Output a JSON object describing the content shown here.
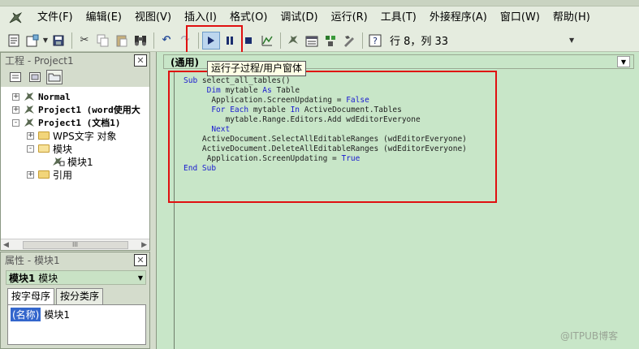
{
  "menubar": {
    "items": [
      "文件(F)",
      "编辑(E)",
      "视图(V)",
      "插入(I)",
      "格式(O)",
      "调试(D)",
      "运行(R)",
      "工具(T)",
      "外接程序(A)",
      "窗口(W)",
      "帮助(H)"
    ]
  },
  "toolbar": {
    "position_text": "行 8，列 33",
    "tooltip": "运行子过程/用户窗体",
    "run_highlight_color": "#e01010"
  },
  "project": {
    "title": "工程 - Project1",
    "tree": [
      {
        "label": "Normal",
        "state": "+"
      },
      {
        "label": "Project1 (word使用大",
        "state": "+"
      },
      {
        "label": "Project1 (文档1)",
        "state": "-"
      },
      {
        "label": "WPS文字 对象",
        "state": "+"
      },
      {
        "label": "模块",
        "state": "-"
      },
      {
        "label": "模块1",
        "state": ""
      },
      {
        "label": "引用",
        "state": "+"
      }
    ],
    "scroll_thumb": "III"
  },
  "properties": {
    "title": "属性 - 模块1",
    "object_name": "模块1",
    "object_type": "模块",
    "tabs": [
      "按字母序",
      "按分类序"
    ],
    "rows": [
      {
        "name": "(名称)",
        "value": "模块1"
      }
    ]
  },
  "code": {
    "object_combo": "(通用)",
    "lines": [
      "Sub select_all_tables()",
      "     Dim mytable As Table",
      "      Application.ScreenUpdating = False",
      "      For Each mytable In ActiveDocument.Tables",
      "         mytable.Range.Editors.Add wdEditorEveryone",
      "      Next",
      "    ActiveDocument.SelectAllEditableRanges (wdEditorEveryone)",
      "    ActiveDocument.DeleteAllEditableRanges (wdEditorEveryone)",
      "     Application.ScreenUpdating = True",
      "End Sub"
    ]
  },
  "watermark": "@ITPUB博客",
  "colors": {
    "code_bg": "#c8e6c8",
    "chrome_bg": "#e5ecdf",
    "keyword": "#1a1ad0"
  }
}
